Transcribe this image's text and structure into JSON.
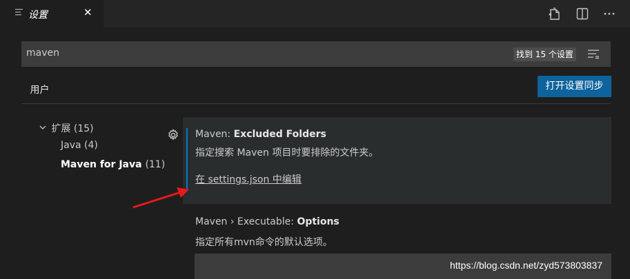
{
  "tab": {
    "title": "设置",
    "icon": "list-icon",
    "close": "✕"
  },
  "editor_actions": [
    "open-json-icon",
    "split-editor-icon",
    "more-actions-icon"
  ],
  "search": {
    "value": "maven",
    "results": "找到 15 个设置",
    "filter_icon": "filter-icon"
  },
  "scope": {
    "user_tab": "用户",
    "sync_button": "打开设置同步"
  },
  "toc": {
    "group": {
      "label": "扩展",
      "count": "(15)"
    },
    "items": [
      {
        "label": "Java",
        "count": "(4)"
      },
      {
        "label": "Maven for Java",
        "count": "(11)"
      }
    ]
  },
  "settings": [
    {
      "category": "Maven: ",
      "name": "Excluded Folders",
      "description": "指定搜索 Maven 项目时要排除的文件夹。",
      "link": "在 settings.json 中编辑"
    },
    {
      "category": "Maven › Executable: ",
      "name": "Options",
      "description": "指定所有mvn命令的默认选项。"
    }
  ],
  "watermark": "https://blog.csdn.net/zyd573803837",
  "colors": {
    "accent": "#007acc",
    "button": "#0e639c",
    "annotation_arrow": "#e8191a"
  }
}
